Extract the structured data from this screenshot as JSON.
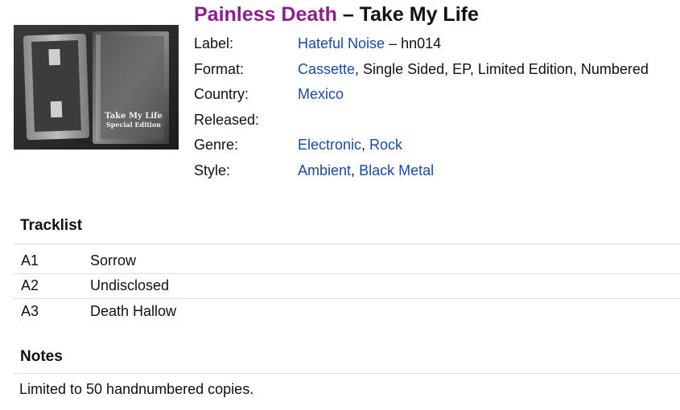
{
  "release": {
    "artist": "Painless Death",
    "separator": "–",
    "title": "Take My Life",
    "cover_text_1": "Take My Life",
    "cover_text_2": "Special Edition"
  },
  "details": [
    {
      "key": "Label:",
      "parts": [
        {
          "text": "Hateful Noise",
          "link": true
        },
        {
          "text": " – hn014",
          "link": false
        }
      ]
    },
    {
      "key": "Format:",
      "parts": [
        {
          "text": "Cassette",
          "link": true
        },
        {
          "text": ", Single Sided, EP, Limited Edition, Numbered",
          "link": false
        }
      ]
    },
    {
      "key": "Country:",
      "parts": [
        {
          "text": "Mexico",
          "link": true
        }
      ]
    },
    {
      "key": "Released:",
      "parts": []
    },
    {
      "key": "Genre:",
      "parts": [
        {
          "text": "Electronic",
          "link": true
        },
        {
          "text": ", ",
          "link": false
        },
        {
          "text": "Rock",
          "link": true
        }
      ]
    },
    {
      "key": "Style:",
      "parts": [
        {
          "text": "Ambient",
          "link": true
        },
        {
          "text": ", ",
          "link": false
        },
        {
          "text": "Black Metal",
          "link": true
        }
      ]
    }
  ],
  "tracklist": {
    "heading": "Tracklist",
    "tracks": [
      {
        "position": "A1",
        "title": "Sorrow"
      },
      {
        "position": "A2",
        "title": "Undisclosed"
      },
      {
        "position": "A3",
        "title": "Death Hallow"
      }
    ]
  },
  "notes": {
    "heading": "Notes",
    "text": "Limited to 50 handnumbered copies."
  },
  "colors": {
    "artist": "#8e1d8e",
    "link": "#1a4aa8",
    "rule": "#dcdcdc"
  }
}
